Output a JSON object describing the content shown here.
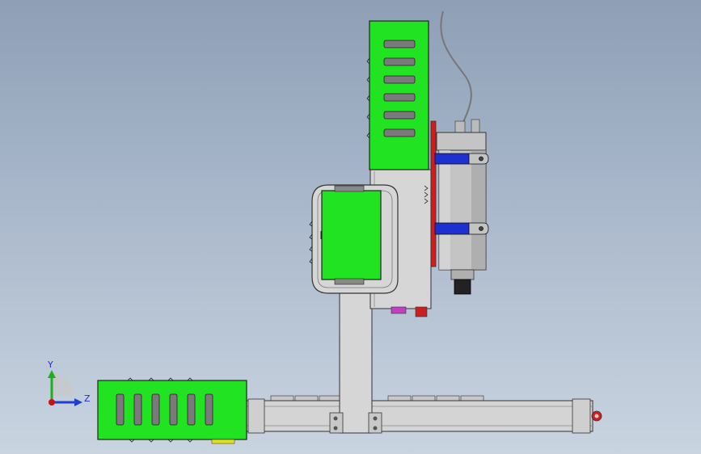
{
  "viewport": {
    "background_top": "#8e9fb6",
    "background_bottom": "#c9d4e0"
  },
  "colors": {
    "green_part": "#22e322",
    "gray_part": "#d2d2d2",
    "spindle_body": "#c4c4c4",
    "clamp_blue": "#1f2fd0",
    "red_plate": "#d21c1c",
    "outline": "#222222"
  },
  "triad": {
    "y_label": "Y",
    "z_label": "Z",
    "y_color": "#1fae1f",
    "z_color": "#1f3fd0",
    "origin_color": "#cc1111"
  },
  "parts": [
    "upper-motor-housing",
    "spindle-motor",
    "spindle-clamp",
    "z-carriage-plate",
    "carriage-motor-housing",
    "vertical-column",
    "base-rail",
    "base-motor-housing"
  ]
}
